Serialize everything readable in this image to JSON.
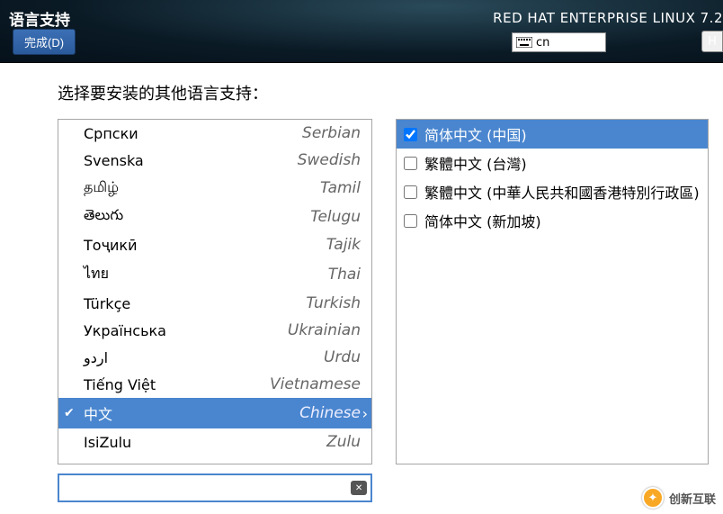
{
  "header": {
    "title": "语言支持",
    "done_label": "完成(D)",
    "product": "RED HAT ENTERPRISE LINUX 7.2",
    "kbd_layout": "cn",
    "help_label": "H"
  },
  "subtitle": "选择要安装的其他语言支持：",
  "languages": [
    {
      "native": "Српски",
      "english": "Serbian",
      "selected": false
    },
    {
      "native": "Svenska",
      "english": "Swedish",
      "selected": false
    },
    {
      "native": "தமிழ்",
      "english": "Tamil",
      "selected": false
    },
    {
      "native": "తెలుగు",
      "english": "Telugu",
      "selected": false
    },
    {
      "native": "Тоҷикӣ",
      "english": "Tajik",
      "selected": false
    },
    {
      "native": "ไทย",
      "english": "Thai",
      "selected": false
    },
    {
      "native": "Türkçe",
      "english": "Turkish",
      "selected": false
    },
    {
      "native": "Українська",
      "english": "Ukrainian",
      "selected": false
    },
    {
      "native": "اردو",
      "english": "Urdu",
      "selected": false
    },
    {
      "native": "Tiếng Việt",
      "english": "Vietnamese",
      "selected": false
    },
    {
      "native": "中文",
      "english": "Chinese",
      "selected": true
    },
    {
      "native": "IsiZulu",
      "english": "Zulu",
      "selected": false
    }
  ],
  "locales": [
    {
      "label": "简体中文 (中国)",
      "checked": true,
      "selected": true
    },
    {
      "label": "繁體中文 (台灣)",
      "checked": false,
      "selected": false
    },
    {
      "label": "繁體中文 (中華人民共和國香港特別行政區)",
      "checked": false,
      "selected": false
    },
    {
      "label": "简体中文 (新加坡)",
      "checked": false,
      "selected": false
    }
  ],
  "search": {
    "value": "",
    "placeholder": ""
  },
  "watermark": {
    "text": "创新互联"
  }
}
